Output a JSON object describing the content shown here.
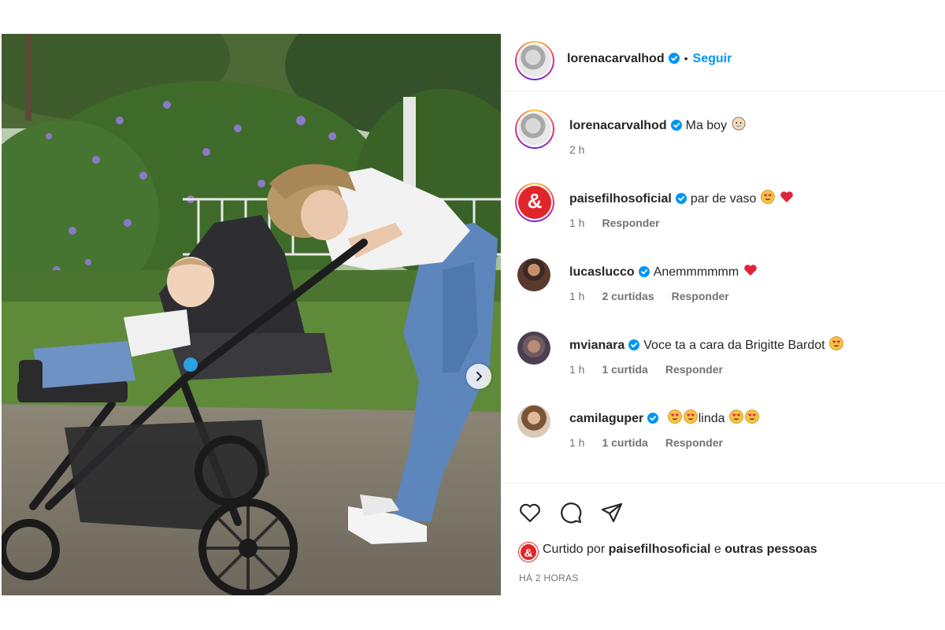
{
  "post": {
    "author": "lorenacarvalhod",
    "separator": "•",
    "follow_label": "Seguir"
  },
  "comments": [
    {
      "user": "lorenacarvalhod",
      "text": "Ma boy",
      "time": "2 h",
      "likes": "",
      "reply": ""
    },
    {
      "user": "paisefilhosoficial",
      "text": "par de vaso",
      "time": "1 h",
      "likes": "",
      "reply": "Responder"
    },
    {
      "user": "lucaslucco",
      "text": "Anemmmmmm",
      "time": "1 h",
      "likes": "2 curtidas",
      "reply": "Responder"
    },
    {
      "user": "mvianara",
      "text": "Voce ta a cara da Brigitte Bardot",
      "time": "1 h",
      "likes": "1 curtida",
      "reply": "Responder"
    },
    {
      "user": "camilaguper",
      "text": "linda",
      "time": "1 h",
      "likes": "1 curtida",
      "reply": "Responder"
    }
  ],
  "likes": {
    "prefix": "Curtido por",
    "user": "paisefilhosoficial",
    "conj": "e",
    "others": "outras pessoas",
    "logo_char": "&"
  },
  "posted": "HÁ 2 HORAS",
  "icons": [
    "verified-icon",
    "heart-icon",
    "comment-icon",
    "share-icon",
    "chevron-right-icon"
  ],
  "colors": {
    "accent": "#0095f6",
    "brand_red": "#e1262b",
    "heart": "#ed4956"
  }
}
